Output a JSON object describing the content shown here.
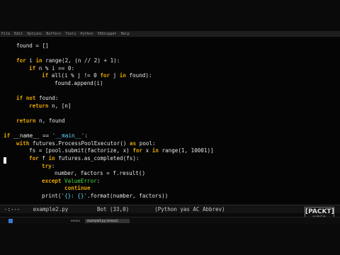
{
  "menubar": {
    "items": [
      "File",
      "Edit",
      "Options",
      "Buffers",
      "Tools",
      "Python",
      "YASnippet",
      "Help"
    ]
  },
  "code": {
    "l01": "found = []",
    "l02a": "for",
    "l02b": " i ",
    "l02c": "in",
    "l02d": " range(2, (n // 2) + 1):",
    "l03a": "if",
    "l03b": " n % i == 0:",
    "l04a": "if",
    "l04b": " all(i % j != 0 ",
    "l04c": "for",
    "l04d": " j ",
    "l04e": "in",
    "l04f": " found):",
    "l05": "found.append(i)",
    "l06a": "if not",
    "l06b": " found:",
    "l07a": "return",
    "l07b": " n, [n]",
    "l08a": "return",
    "l08b": " n, found",
    "l09a": "if",
    "l09b": " __name__ == ",
    "l09c": "'__main__'",
    "l09d": ":",
    "l10a": "with",
    "l10b": " futures.ProcessPoolExecutor() ",
    "l10c": "as",
    "l10d": " pool:",
    "l11a": "fs = [pool.submit(factorize, x) ",
    "l11b": "for",
    "l11c": " x ",
    "l11d": "in",
    "l11e": " range(1, 10001)]",
    "l12a": "for",
    "l12b": " f ",
    "l12c": "in",
    "l12d": " futures.as_completed(fs):",
    "l13a": "try",
    "l13b": ":",
    "l14": "number, factors = f.result()",
    "l15a": "except",
    "l15b": " ",
    "l15c": "ValueError",
    "l15d": ":",
    "l16": "continue",
    "l17a": "print(",
    "l17b": "'{}: {}'",
    "l17c": ".format(number, factors))"
  },
  "modeline": {
    "status": "-:---",
    "filename": "example2.py",
    "position": "Bot (33,0)",
    "modes": "(Python yas AC Abbrev)"
  },
  "logo": {
    "main": "[PACKT]",
    "sub": "VIDEO"
  },
  "taskbar": {
    "app_label": "emacs",
    "window_title": "example2.py (emacs)"
  },
  "colors": {
    "keyword": "#e6a400",
    "string": "#5fd7ff",
    "exception": "#44dd44"
  }
}
